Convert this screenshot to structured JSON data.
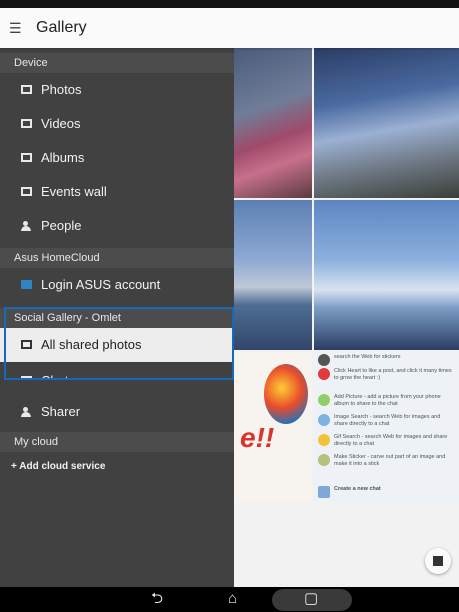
{
  "app": {
    "title": "Gallery",
    "menu_icon": "hamburger-icon"
  },
  "drawer": {
    "sections": {
      "device": "Device",
      "homecloud": "Asus HomeCloud",
      "social": "Social Gallery - Omlet",
      "mycloud": "My cloud"
    },
    "items": {
      "photos": {
        "label": "Photos",
        "icon": "photos-icon"
      },
      "videos": {
        "label": "Videos",
        "icon": "videos-icon"
      },
      "albums": {
        "label": "Albums",
        "icon": "albums-icon"
      },
      "events": {
        "label": "Events wall",
        "icon": "calendar-icon"
      },
      "people": {
        "label": "People",
        "icon": "person-icon"
      },
      "login": {
        "label": "Login ASUS account",
        "icon": "asus-cloud-icon"
      },
      "shared": {
        "label": "All shared photos",
        "icon": "shared-photos-icon"
      },
      "chat": {
        "label": "Chat room",
        "icon": "chat-icon"
      },
      "sharer": {
        "label": "Sharer",
        "icon": "sharer-icon"
      }
    },
    "add_cloud": "+ Add cloud service"
  },
  "omlet_tips": [
    {
      "text": "search the Web for stickers",
      "color": "#555555"
    },
    {
      "text": "Click Heart to like a post, and click it many times to grow the heart :)",
      "color": "#e03a3a"
    },
    {
      "text": "Add Picture - add a picture from your phone album to share to the chat",
      "color": "#8fcf6a"
    },
    {
      "text": "Image Search - search Web for images and share directly to a chat",
      "color": "#7fb2e0"
    },
    {
      "text": "Gif Search - search Web for images and share directly to a chat",
      "color": "#f3c23b"
    },
    {
      "text": "Make Sticker - carve out part of an image and make it into a stick",
      "color": "#b5c07a"
    },
    {
      "text": "Create a new chat",
      "color": "#7fa8d8"
    }
  ],
  "navbar": {
    "back": "back-icon",
    "home": "home-icon",
    "recents": "recents-icon"
  },
  "colors": {
    "highlight": "#1668b8",
    "drawer_bg": "#414141",
    "selected_bg": "#ededed"
  }
}
